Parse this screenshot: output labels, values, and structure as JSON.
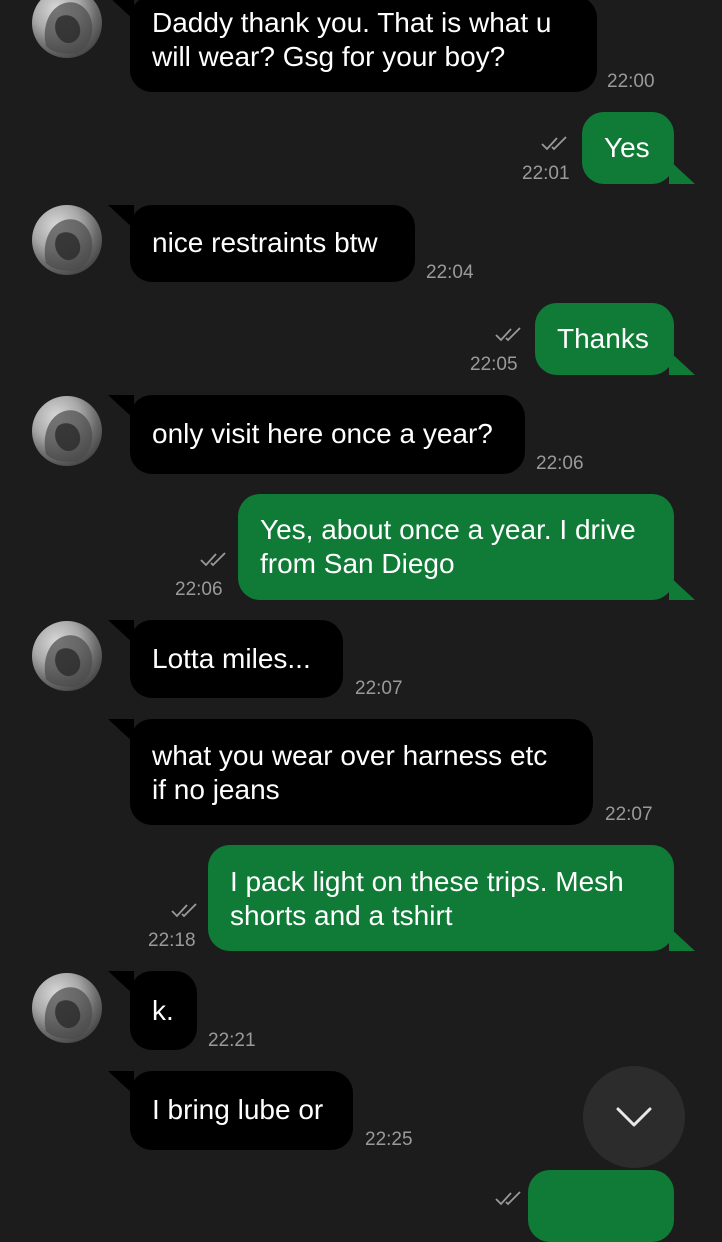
{
  "messages": [
    {
      "dir": "in",
      "text": "Daddy thank you. That is what u\nwill wear? Gsg for your boy?",
      "time": "22:00"
    },
    {
      "dir": "out",
      "text": "Yes",
      "time": "22:01"
    },
    {
      "dir": "in",
      "text": "nice restraints btw",
      "time": "22:04"
    },
    {
      "dir": "out",
      "text": "Thanks",
      "time": "22:05"
    },
    {
      "dir": "in",
      "text": "only visit here once a year?",
      "time": "22:06"
    },
    {
      "dir": "out",
      "text": "Yes, about once a year. I drive\nfrom San Diego",
      "time": "22:06"
    },
    {
      "dir": "in",
      "text": "Lotta miles...",
      "time": "22:07"
    },
    {
      "dir": "in",
      "text": "what you wear over harness etc\nif no jeans",
      "time": "22:07"
    },
    {
      "dir": "out",
      "text": "I pack light on these trips. Mesh\nshorts and a tshirt",
      "time": "22:18"
    },
    {
      "dir": "in",
      "text": "k.",
      "time": "22:21"
    },
    {
      "dir": "in",
      "text": "I bring lube or",
      "time": "22:25"
    },
    {
      "dir": "out",
      "text": "",
      "time": ""
    }
  ],
  "icons": {
    "read_receipt": "double-check-icon",
    "scroll": "chevron-down-icon",
    "avatar": "contact-avatar"
  },
  "colors": {
    "background": "#1c1c1c",
    "incoming": "#000000",
    "outgoing": "#0f7b37",
    "timestamp": "#9a9a9a"
  }
}
